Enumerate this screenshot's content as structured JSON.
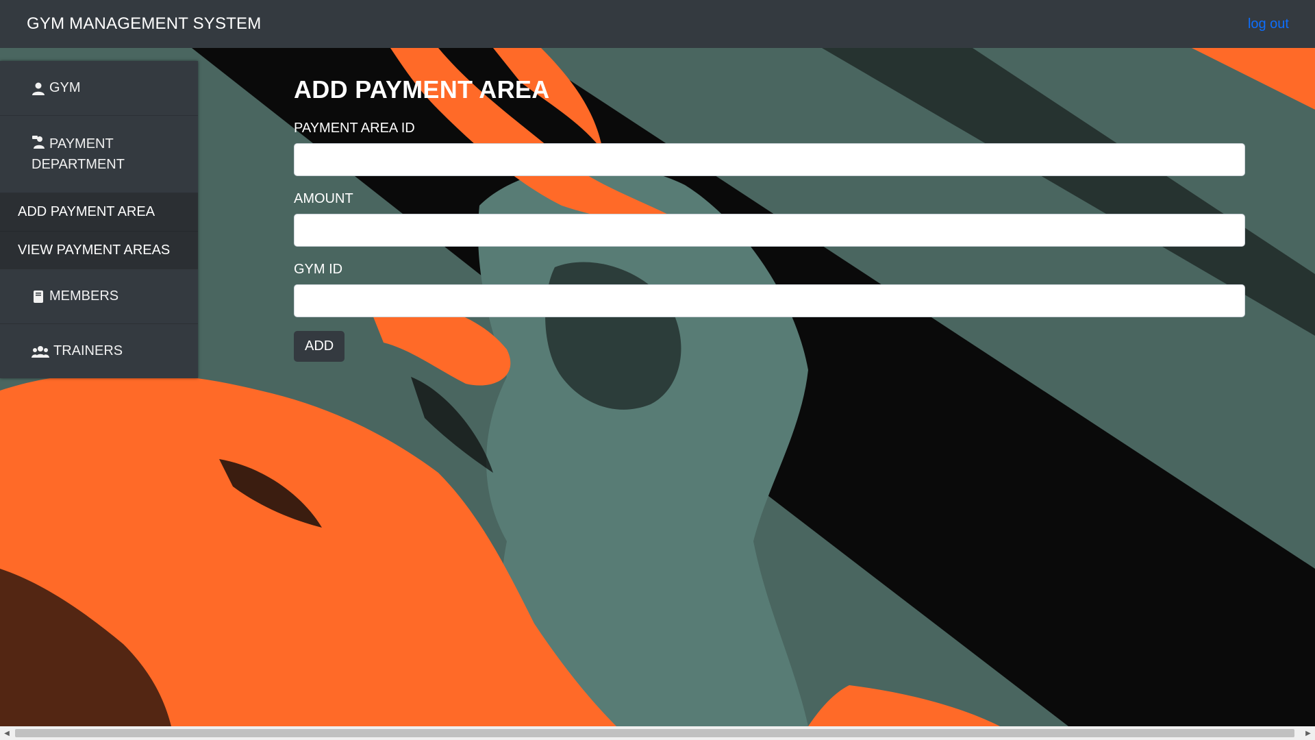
{
  "header": {
    "title": "GYM MANAGEMENT SYSTEM",
    "logout_label": "log out"
  },
  "sidebar": {
    "items": [
      {
        "label": "GYM",
        "icon": "user-icon"
      },
      {
        "label": "PAYMENT",
        "label2": "DEPARTMENT",
        "icon": "cashier-icon"
      },
      {
        "label": "MEMBERS",
        "icon": "book-icon"
      },
      {
        "label": "TRAINERS",
        "icon": "users-icon"
      }
    ],
    "submenu": [
      {
        "label": "ADD PAYMENT AREA"
      },
      {
        "label": "VIEW PAYMENT AREAS"
      }
    ]
  },
  "form": {
    "title": "ADD PAYMENT AREA",
    "fields": [
      {
        "label": "PAYMENT AREA ID",
        "value": ""
      },
      {
        "label": "AMOUNT",
        "value": ""
      },
      {
        "label": "GYM ID",
        "value": ""
      }
    ],
    "submit_label": "ADD"
  },
  "colors": {
    "navbar": "#343a40",
    "link": "#0d6efd",
    "background_teal": "#4a6660",
    "background_orange": "#ff6a28",
    "background_dark": "#0a0a0a"
  }
}
